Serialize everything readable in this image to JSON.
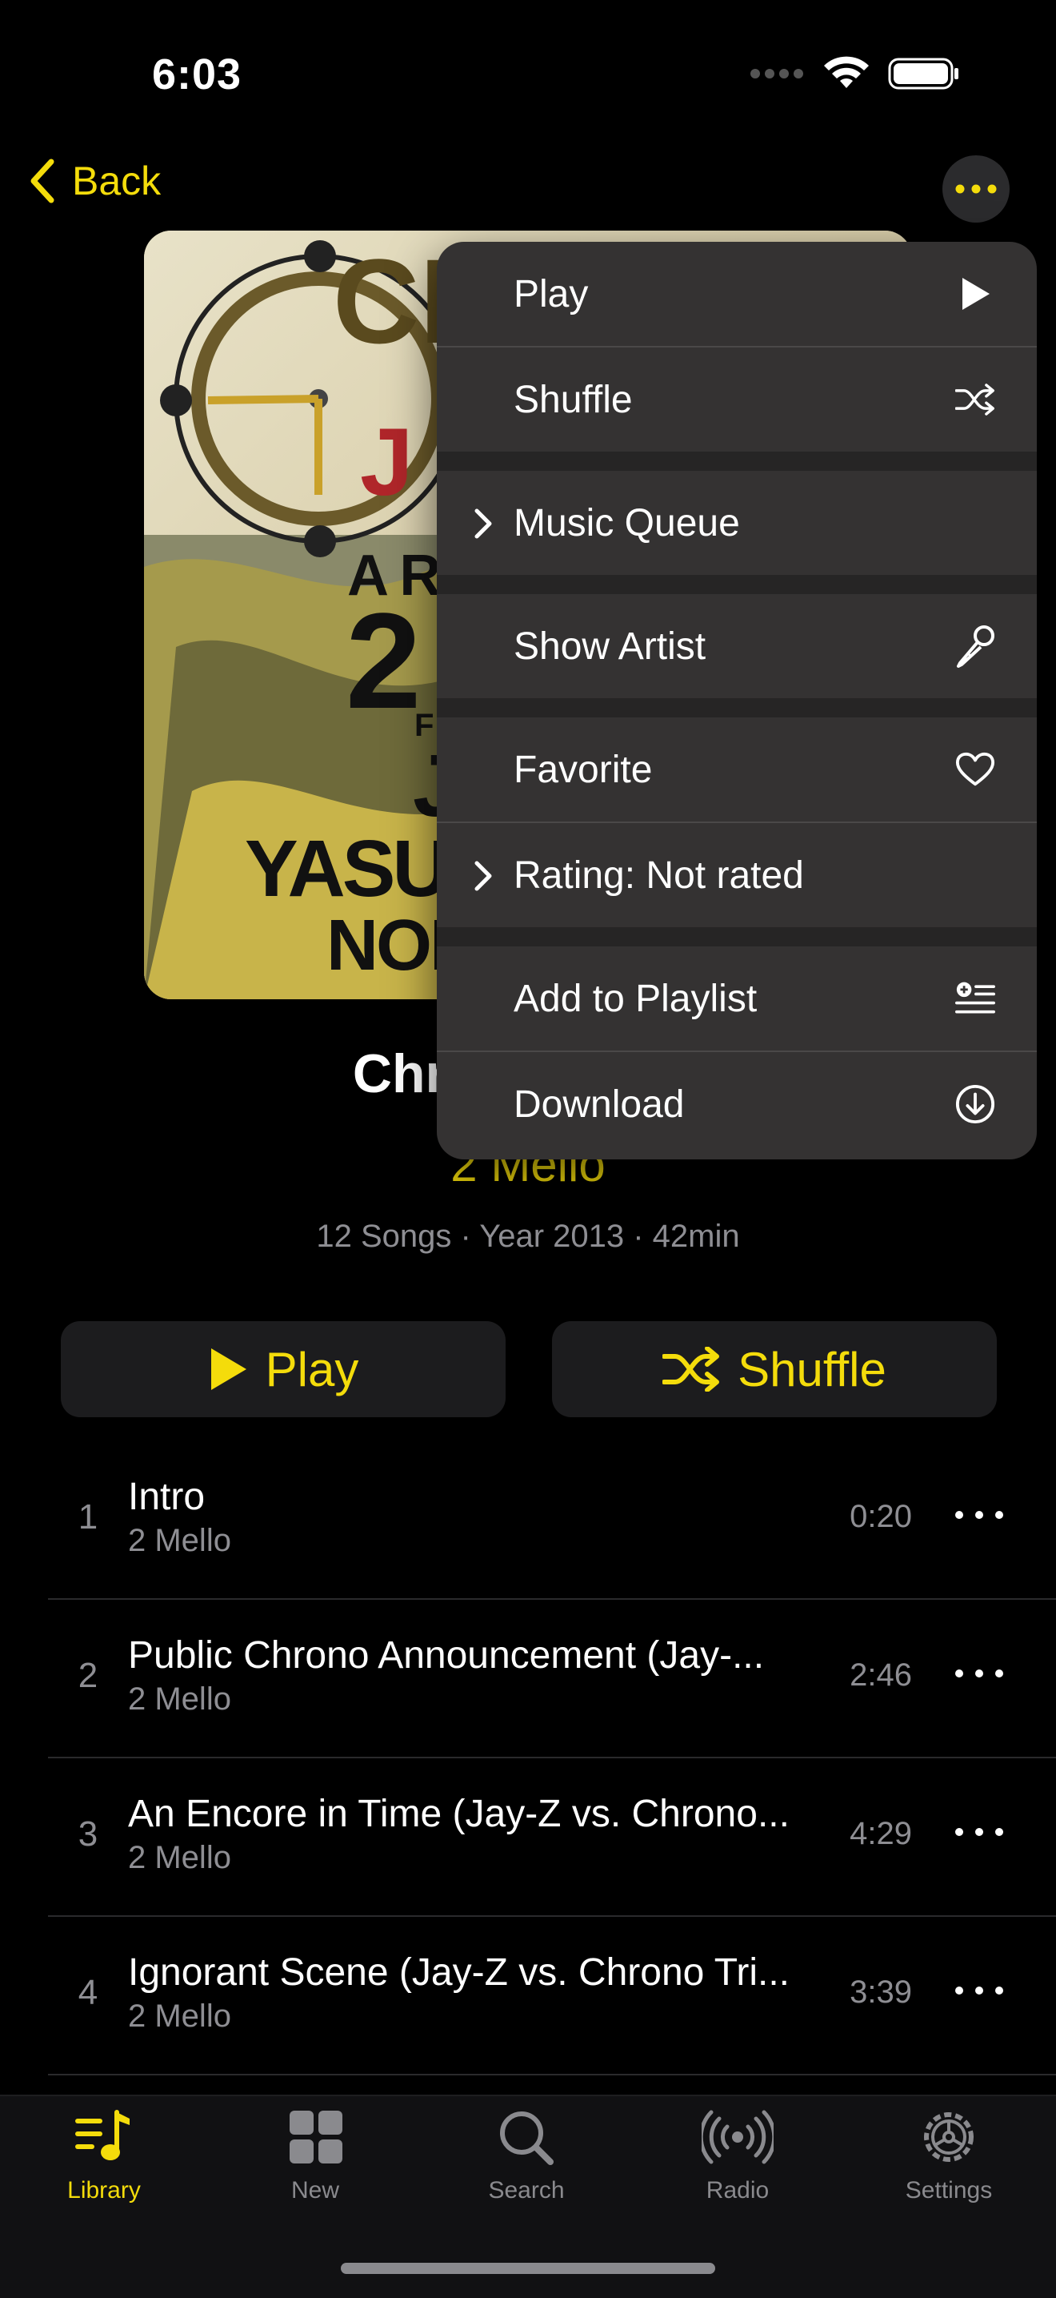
{
  "status_bar": {
    "time": "6:03"
  },
  "nav": {
    "back_label": "Back"
  },
  "album": {
    "title": "Chrono Jigga",
    "artist": "2 Mello",
    "meta": "12 Songs · Year 2013 · 42min",
    "art_texts": [
      "A RE",
      "2",
      "F",
      "J",
      "YASUN",
      "NOBU"
    ]
  },
  "actions": {
    "play_label": "Play",
    "shuffle_label": "Shuffle"
  },
  "tracks": [
    {
      "num": "1",
      "title": "Intro",
      "artist": "2 Mello",
      "duration": "0:20"
    },
    {
      "num": "2",
      "title": "Public Chrono Announcement (Jay-...",
      "artist": "2 Mello",
      "duration": "2:46"
    },
    {
      "num": "3",
      "title": "An Encore in Time (Jay-Z vs. Chrono...",
      "artist": "2 Mello",
      "duration": "4:29"
    },
    {
      "num": "4",
      "title": "Ignorant Scene (Jay-Z vs. Chrono Tri...",
      "artist": "2 Mello",
      "duration": "3:39"
    }
  ],
  "menu": {
    "items": [
      {
        "label": "Play",
        "icon": "play-icon"
      },
      {
        "label": "Shuffle",
        "icon": "shuffle-icon"
      },
      {
        "label": "Music Queue",
        "icon": "chevron-right-icon"
      },
      {
        "label": "Show Artist",
        "icon": "microphone-icon"
      },
      {
        "label": "Favorite",
        "icon": "heart-icon"
      },
      {
        "label": "Rating: Not rated",
        "icon": "chevron-right-icon"
      },
      {
        "label": "Add to Playlist",
        "icon": "add-to-playlist-icon"
      },
      {
        "label": "Download",
        "icon": "download-icon"
      }
    ]
  },
  "tabs": [
    {
      "label": "Library",
      "icon": "library-icon",
      "active": true
    },
    {
      "label": "New",
      "icon": "grid-icon",
      "active": false
    },
    {
      "label": "Search",
      "icon": "search-icon",
      "active": false
    },
    {
      "label": "Radio",
      "icon": "radio-icon",
      "active": false
    },
    {
      "label": "Settings",
      "icon": "gear-icon",
      "active": false
    }
  ],
  "colors": {
    "accent": "#f4dc0b",
    "background": "#000000",
    "secondary_text": "#8e8e93"
  }
}
